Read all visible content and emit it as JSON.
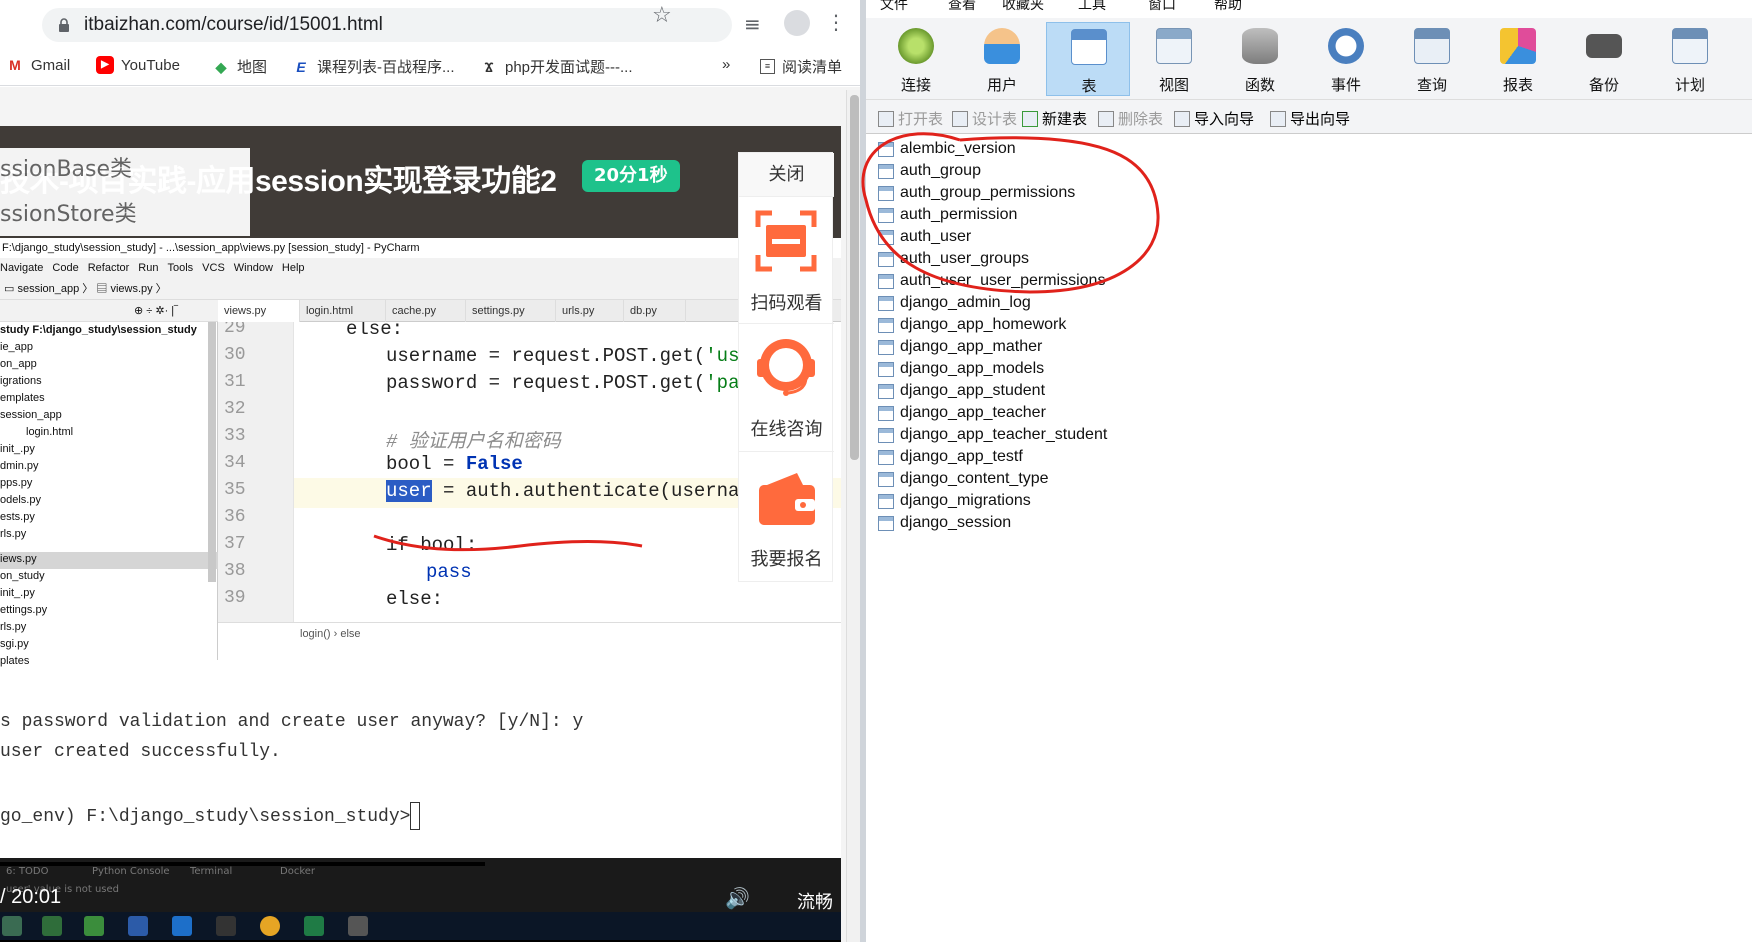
{
  "browser": {
    "url": "itbaizhan.com/course/id/15001.html",
    "bookmarks": [
      {
        "label": "Gmail",
        "icon": "gmail-icon",
        "color": "#d93025"
      },
      {
        "label": "YouTube",
        "icon": "youtube-icon",
        "color": "#ff0000"
      },
      {
        "label": "地图",
        "icon": "maps-icon",
        "color": "#34a853"
      },
      {
        "label": "课程列表-百战程序...",
        "icon": "course-icon",
        "color": "#1a4fbf"
      },
      {
        "label": "php开发面试题---...",
        "icon": "bookmark-icon",
        "color": "#333333"
      }
    ],
    "more": "»",
    "reading_list": "阅读清单"
  },
  "video": {
    "title": "技术-项目实践-应用session实现登录功能2",
    "duration_badge": "20分1秒",
    "popup_lines": [
      "ssionBase类",
      "ssionStore类"
    ],
    "time": "/ 20:01",
    "quality": "流畅",
    "bottom_status": "user' value is not used",
    "bottom_tabs": [
      "6: TODO",
      "Python Console",
      "Terminal",
      "Docker"
    ]
  },
  "ide": {
    "title": "F:\\django_study\\session_study] - ...\\session_app\\views.py [session_study] - PyCharm",
    "menu": [
      "Navigate",
      "Code",
      "Refactor",
      "Run",
      "Tools",
      "VCS",
      "Window",
      "Help"
    ],
    "breadcrumb": [
      "session_app",
      "views.py"
    ],
    "project_root": "study F:\\django_study\\session_study",
    "tree": [
      "ie_app",
      "on_app",
      "igrations",
      "emplates",
      "session_app",
      "login.html",
      "init_.py",
      "dmin.py",
      "pps.py",
      "odels.py",
      "ests.py",
      "rls.py",
      "iews.py",
      "on_study",
      "init_.py",
      "ettings.py",
      "rls.py",
      "sgi.py",
      "plates"
    ],
    "tabs": [
      "views.py",
      "login.html",
      "cache.py",
      "settings.py",
      "urls.py",
      "db.py"
    ],
    "line_numbers": [
      "29",
      "30",
      "31",
      "32",
      "33",
      "34",
      "35",
      "36",
      "37",
      "38",
      "39"
    ],
    "code": {
      "l29": "else:",
      "l30a": "username = request.POST.get(",
      "l30b": "'userna",
      "l31a": "password = request.POST.get(",
      "l31b": "'passwo",
      "l33": "# 验证用户名和密码",
      "l34a": "bool = ",
      "l34b": "False",
      "l35a": "user",
      "l35b": " = auth.authenticate(username=u",
      "l37": "if bool:",
      "l38": "pass",
      "l39": "else:"
    },
    "status": "login()  ›  else"
  },
  "terminal": {
    "line1": "s password validation and create user anyway? [y/N]: y",
    "line2": "user created successfully.",
    "line3": "go_env) F:\\django_study\\session_study>"
  },
  "sidepanel": {
    "close": "关闭",
    "scan": "扫码观看",
    "consult": "在线咨询",
    "enroll": "我要报名"
  },
  "navicat": {
    "menu": [
      "文件",
      "查看",
      "收藏夹",
      "工具",
      "窗口",
      "帮助"
    ],
    "toolbar": [
      "连接",
      "用户",
      "表",
      "视图",
      "函数",
      "事件",
      "查询",
      "报表",
      "备份",
      "计划"
    ],
    "subtoolbar": [
      "打开表",
      "设计表",
      "新建表",
      "删除表",
      "导入向导",
      "导出向导"
    ],
    "tables": [
      "alembic_version",
      "auth_group",
      "auth_group_permissions",
      "auth_permission",
      "auth_user",
      "auth_user_groups",
      "auth_user_user_permissions",
      "django_admin_log",
      "django_app_homework",
      "django_app_mather",
      "django_app_models",
      "django_app_student",
      "django_app_teacher",
      "django_app_teacher_student",
      "django_app_testf",
      "django_content_type",
      "django_migrations",
      "django_session"
    ]
  },
  "colors": {
    "annotation": "#e0221b",
    "badge": "#1ec28b",
    "accent": "#ff6a3d"
  }
}
